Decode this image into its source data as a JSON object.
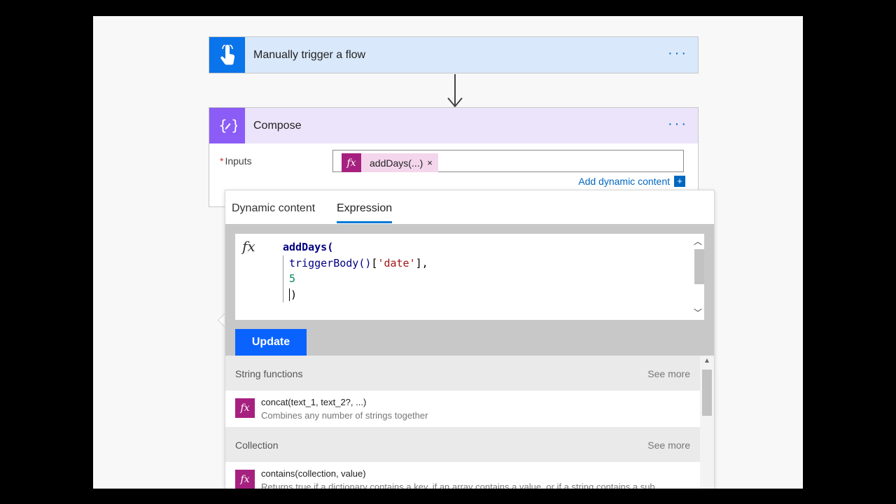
{
  "trigger": {
    "title": "Manually trigger a flow",
    "menu": "···"
  },
  "compose": {
    "title": "Compose",
    "menu": "···",
    "inputs_required": "*",
    "inputs_label": "Inputs",
    "token_label": "addDays(...)",
    "token_remove": "×",
    "add_dynamic": "Add dynamic content",
    "add_dynamic_icon": "+"
  },
  "panel": {
    "tabs": [
      "Dynamic content",
      "Expression"
    ],
    "active_tab": "Expression",
    "fx": "fx",
    "code": {
      "line1": "addDays(",
      "line2_fn": "triggerBody()",
      "line2_open": "[",
      "line2_str": "'date'",
      "line2_close": "],",
      "line3": "5",
      "line4": ")"
    },
    "update": "Update",
    "sections": [
      {
        "name": "String functions",
        "more": "See more",
        "item": {
          "sig": "concat(text_1, text_2?, ...)",
          "desc": "Combines any number of strings together"
        }
      },
      {
        "name": "Collection",
        "more": "See more",
        "item": {
          "sig": "contains(collection, value)",
          "desc": "Returns true if a dictionary contains a key, if an array contains a value, or if a string contains a sub..."
        }
      }
    ]
  },
  "colors": {
    "accent": "#0067c0",
    "update_button": "#0a63ff",
    "fx_icon": "#a6217f",
    "trigger_icon_bg": "#0a74ea",
    "compose_icon_bg": "#8b5cf6"
  }
}
